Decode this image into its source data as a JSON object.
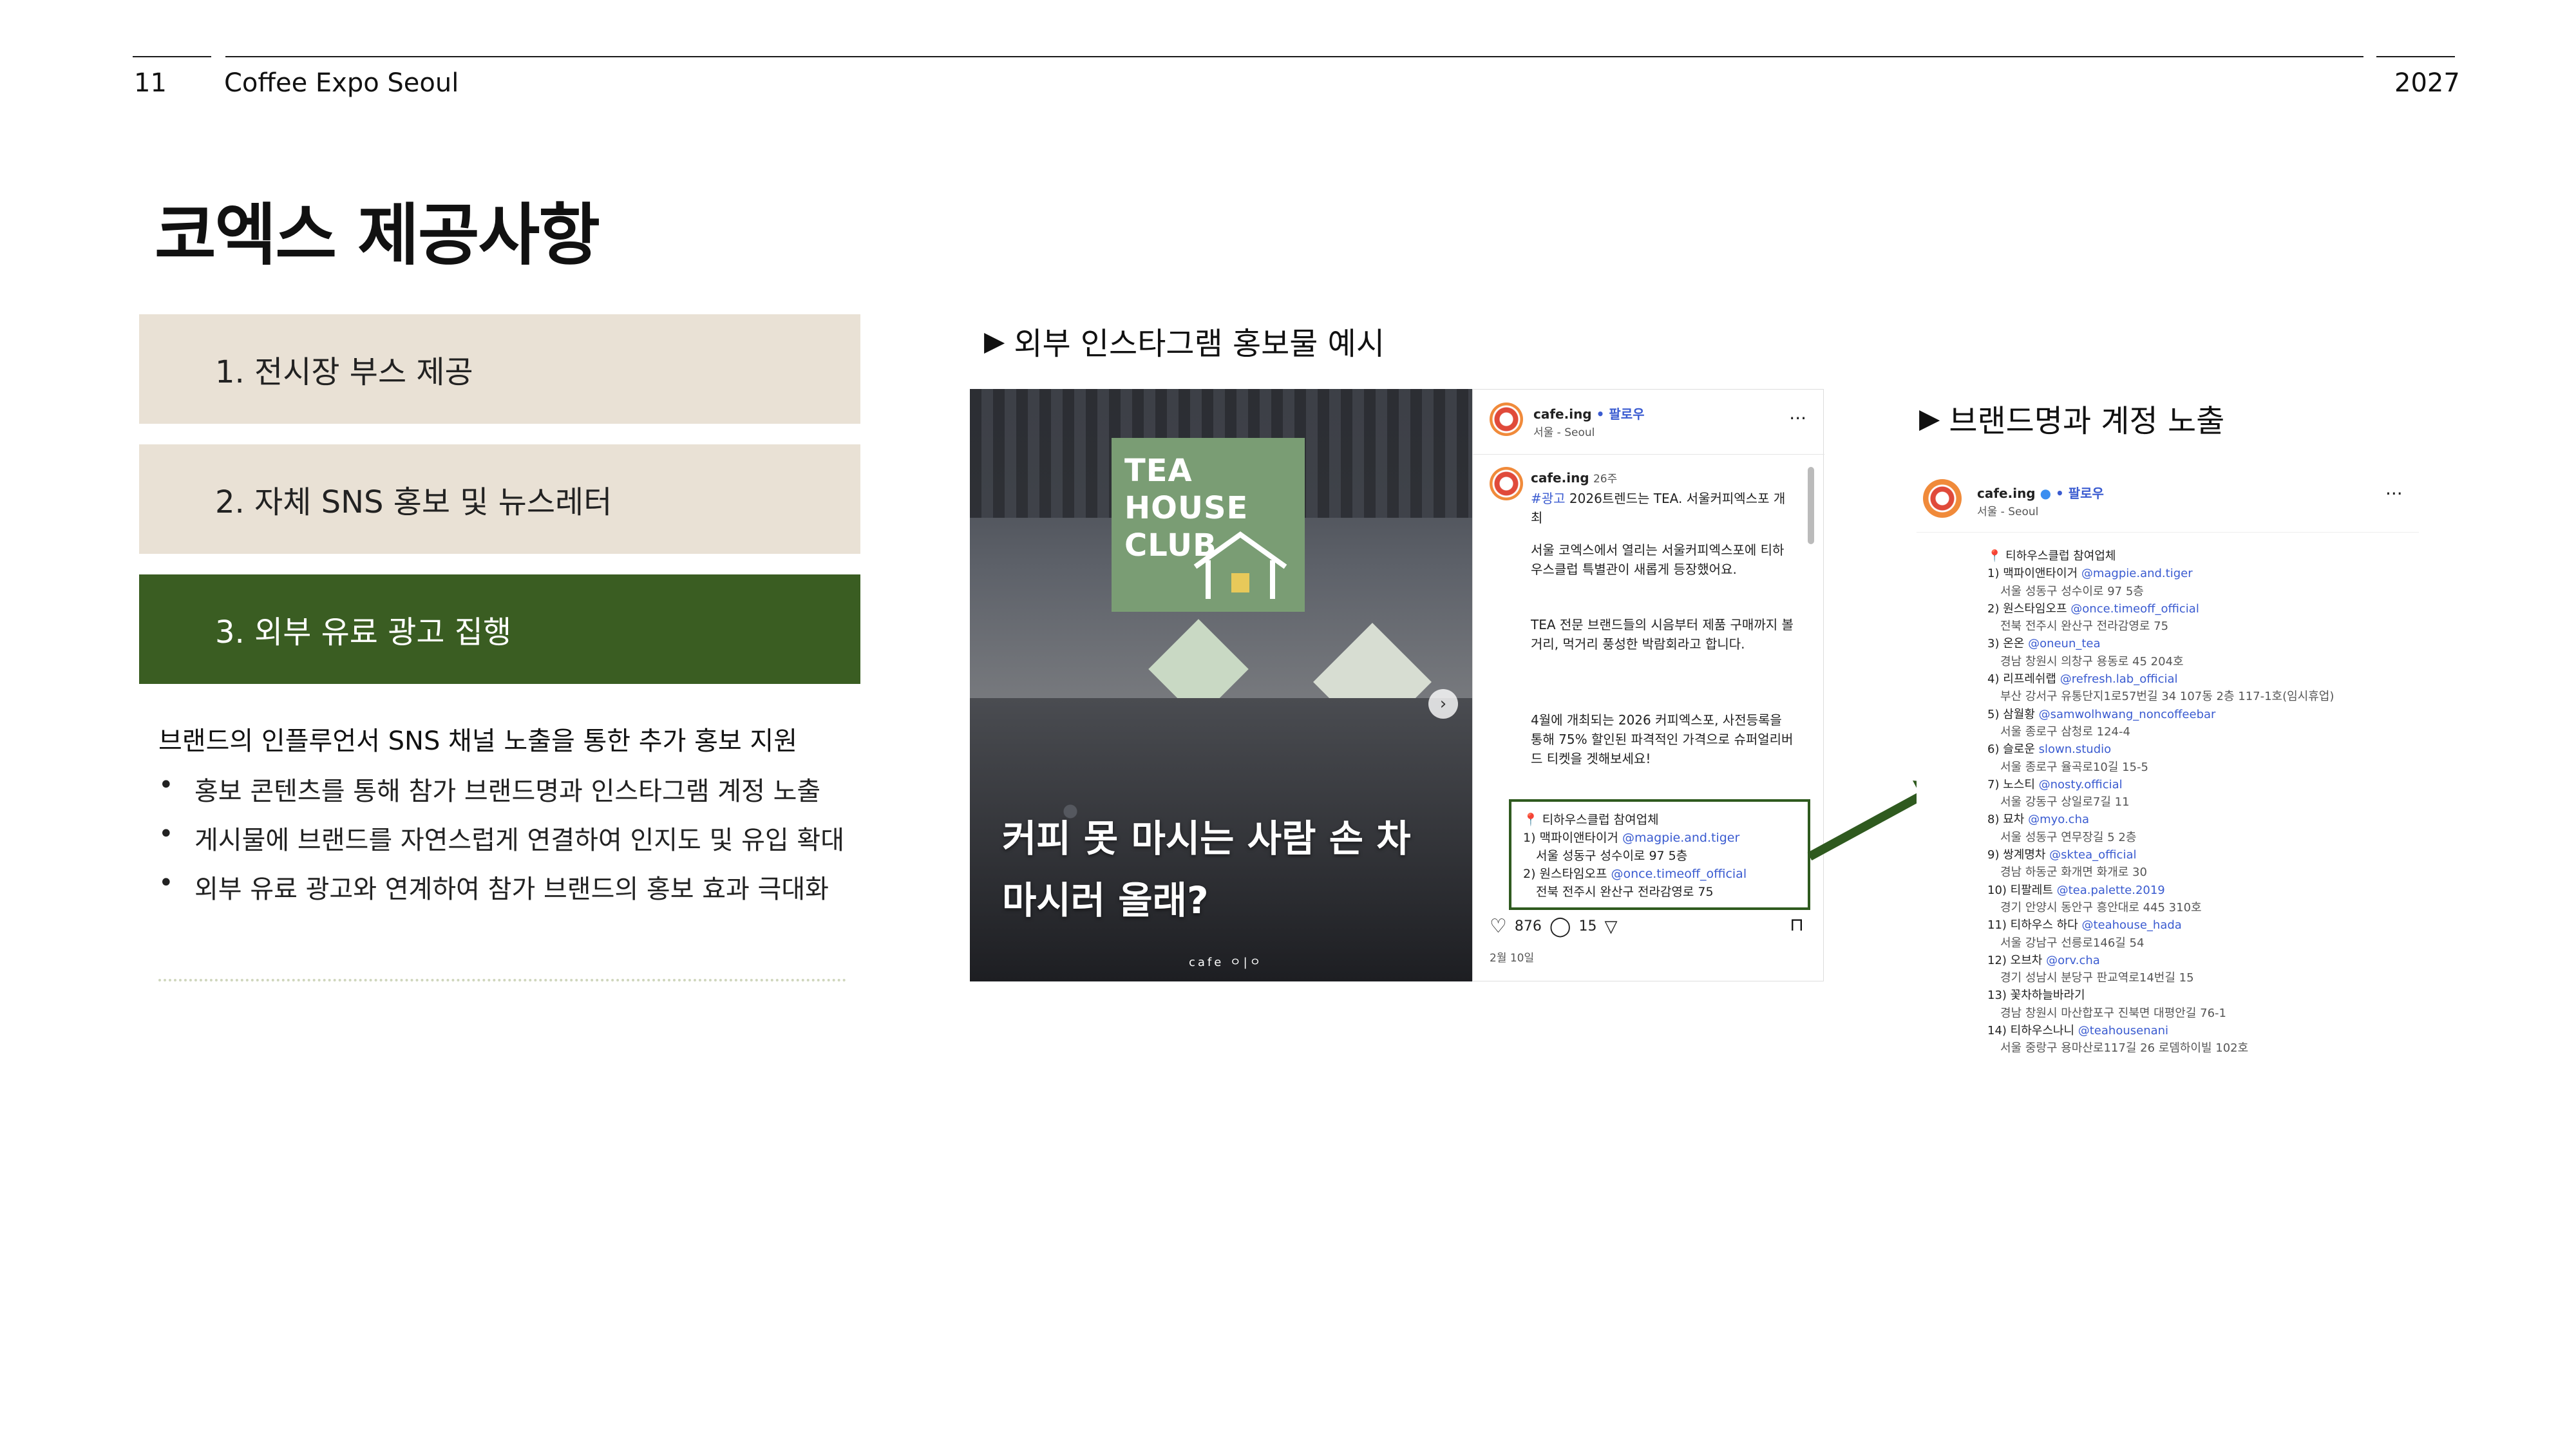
{
  "header": {
    "page_num": "11",
    "event": "Coffee Expo Seoul",
    "year": "2027"
  },
  "title": "코엑스 제공사항",
  "menu": [
    {
      "label": "1. 전시장 부스 제공",
      "active": false
    },
    {
      "label": "2. 자체 SNS 홍보 및 뉴스레터",
      "active": false
    },
    {
      "label": "3. 외부 유료 광고 집행",
      "active": true
    }
  ],
  "description": {
    "heading": "브랜드의 인플루언서 SNS 채널 노출을 통한 추가 홍보 지원",
    "bullets": [
      "홍보 콘텐츠를 통해 참가 브랜드명과 인스타그램 계정 노출",
      "게시물에 브랜드를 자연스럽게 연결하여 인지도 및 유입 확대",
      "외부 유료 광고와 연계하여 참가 브랜드의 홍보 효과 극대화"
    ]
  },
  "section_left": {
    "label": "외부 인스타그램 홍보물 예시"
  },
  "section_right": {
    "label": "브랜드명과 계정 노출"
  },
  "post": {
    "sign": [
      "TEA HOUSE",
      "CLUB"
    ],
    "headline": "커피 못 마시는 사람 손 차 마시러 올래?",
    "mark": "cafe ㅇ|ㅇ",
    "account": "cafe.ing",
    "follow": "• 팔로우",
    "location": "서울 - Seoul",
    "more": "···",
    "age": "26주",
    "caption_tag": "#광고",
    "caption_1": "2026트렌드는 TEA. 서울커피엑스포 개최",
    "caption_2": "서울 코엑스에서 열리는 서울커피엑스포에 티하우스클럽 특별관이 새롭게 등장했어요.",
    "caption_3": "TEA 전문 브랜드들의 시음부터 제품 구매까지 볼거리, 먹거리 풍성한 박람회라고 합니다.",
    "caption_4": "4월에 개최되는 2026 커피엑스포, 사전등록을 통해 75% 할인된 파격적인 가격으로 슈퍼얼리버드 티켓을 겟해보세요!",
    "box_title": "티하우스클럽 참여업체",
    "box_1": "1) 맥파이앤타이거",
    "box_1_link": "@magpie.and.tiger",
    "box_1_addr": "서울 성동구 성수이로 97 5층",
    "box_2": "2) 원스타임오프",
    "box_2_link": "@once.timeoff_official",
    "box_2_addr": "전북 전주시 완산구 전라감영로 75",
    "likes": "876",
    "comments": "15",
    "date": "2월 10일"
  },
  "brand_list": {
    "account": "cafe.ing",
    "follow": "• 팔로우",
    "location": "서울 - Seoul",
    "more": "···",
    "title": "티하우스클럽 참여업체",
    "items": [
      {
        "name": "1) 맥파이앤타이거",
        "handle": "@magpie.and.tiger",
        "addr": "서울 성동구 성수이로 97 5층"
      },
      {
        "name": "2) 원스타임오프",
        "handle": "@once.timeoff_official",
        "addr": "전북 전주시 완산구 전라감영로 75"
      },
      {
        "name": "3) 온온",
        "handle": "@oneun_tea",
        "addr": "경남 창원시 의창구 용동로 45 204호"
      },
      {
        "name": "4) 리프레쉬랩",
        "handle": "@refresh.lab_official",
        "addr": "부산 강서구 유통단지1로57번길 34 107동 2층 117-1호(임시휴업)"
      },
      {
        "name": "5) 삼월황",
        "handle": "@samwolhwang_noncoffeebar",
        "addr": "서울 종로구 삼청로 124-4"
      },
      {
        "name": "6) 슬로운",
        "handle": "slown.studio",
        "addr": "서울 종로구 율곡로10길 15-5"
      },
      {
        "name": "7) 노스티",
        "handle": "@nosty.official",
        "addr": "서울 강동구 상일로7길 11"
      },
      {
        "name": "8) 묘차",
        "handle": "@myo.cha",
        "addr": "서울 성동구 연무장길 5 2층"
      },
      {
        "name": "9) 쌍계명차",
        "handle": "@sktea_official",
        "addr": "경남 하동군 화개면 화개로 30"
      },
      {
        "name": "10) 티팔레트",
        "handle": "@tea.palette.2019",
        "addr": "경기 안양시 동안구 흥안대로 445 310호"
      },
      {
        "name": "11) 티하우스 하다",
        "handle": "@teahouse_hada",
        "addr": "서울 강남구 선릉로146길 54"
      },
      {
        "name": "12) 오브차",
        "handle": "@orv.cha",
        "addr": "경기 성남시 분당구 판교역로14번길 15"
      },
      {
        "name": "13) 꽃차하늘바라기",
        "handle": "",
        "addr": "경남 창원시 마산합포구 진북면 대평안길 76-1"
      },
      {
        "name": "14) 티하우스나니",
        "handle": "@teahousenani",
        "addr": "서울 중랑구 용마산로117길 26 로뎀하이빌 102호"
      }
    ]
  },
  "colors": {
    "accent_green": "#3a5d22",
    "beige": "#e9e1d5",
    "link_blue": "#3a5bd0"
  }
}
